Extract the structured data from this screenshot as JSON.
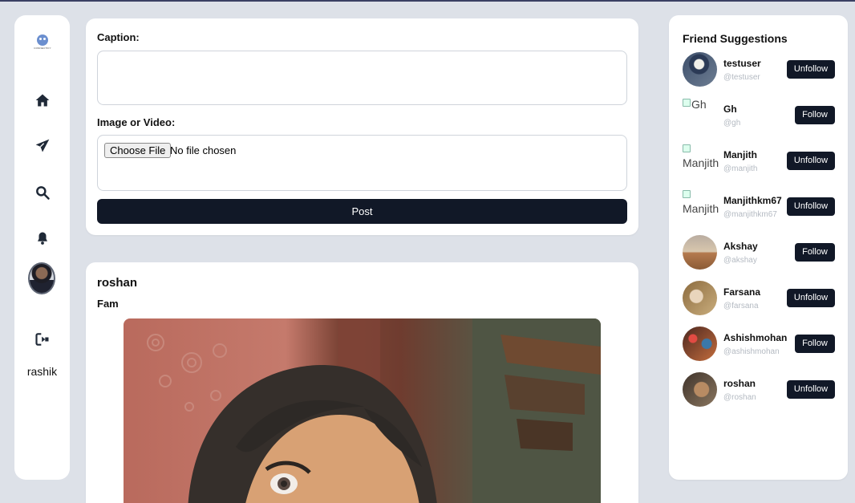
{
  "composer": {
    "caption_label": "Caption:",
    "caption_value": "",
    "media_label": "Image or Video:",
    "file_button": "Choose File",
    "file_status": "No file chosen",
    "post_button": "Post"
  },
  "sidebar": {
    "logo_text": "CONNECTIFY",
    "icons": [
      "home-icon",
      "send-icon",
      "search-icon",
      "bell-icon",
      "logout-icon"
    ],
    "username": "rashik"
  },
  "post": {
    "author": "roshan",
    "text": "Fam"
  },
  "suggestions": {
    "title": "Friend Suggestions",
    "users": [
      {
        "name": "testuser",
        "handle": "@testuser",
        "action": "Unfollow",
        "image_alt": "",
        "avatar_color": "#3d4f6b"
      },
      {
        "name": "Gh",
        "handle": "@gh",
        "action": "Follow",
        "image_alt": "Gh",
        "avatar_color": ""
      },
      {
        "name": "Manjith",
        "handle": "@manjith",
        "action": "Unfollow",
        "image_alt": "Manjith",
        "avatar_color": ""
      },
      {
        "name": "Manjithkm67",
        "handle": "@manjithkm67",
        "action": "Unfollow",
        "image_alt": "Manjith",
        "avatar_color": ""
      },
      {
        "name": "Akshay",
        "handle": "@akshay",
        "action": "Follow",
        "image_alt": "",
        "avatar_color": "#b48a66"
      },
      {
        "name": "Farsana",
        "handle": "@farsana",
        "action": "Unfollow",
        "image_alt": "",
        "avatar_color": "#9a7a4d"
      },
      {
        "name": "Ashishmohan",
        "handle": "@ashishmohan",
        "action": "Follow",
        "image_alt": "",
        "avatar_color": "#5a2f2a"
      },
      {
        "name": "roshan",
        "handle": "@roshan",
        "action": "Unfollow",
        "image_alt": "",
        "avatar_color": "#5b4a3d"
      }
    ]
  },
  "colors": {
    "background": "#dde1e8",
    "button": "#111827",
    "card": "#ffffff"
  }
}
